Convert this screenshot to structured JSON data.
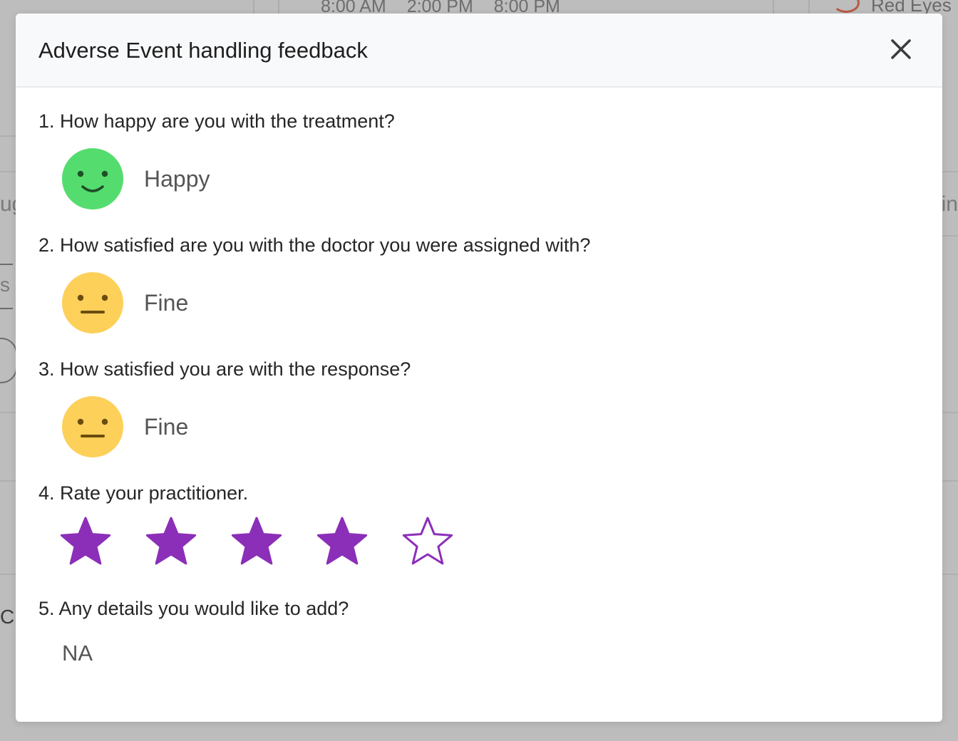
{
  "background": {
    "times": [
      "8:00 AM",
      "2:00 PM",
      "8:00 PM"
    ],
    "top_right_text": "Red Eyes",
    "left_fragments": [
      "ug",
      "s",
      "C"
    ],
    "right_fragments": [
      "in"
    ]
  },
  "modal": {
    "title": "Adverse Event handling feedback",
    "questions": [
      {
        "label": "1. How happy are you with the treatment?",
        "answer": "Happy",
        "face": "smile-face-icon",
        "color": "#55dc6e"
      },
      {
        "label": "2. How satisfied are you with the doctor you were assigned with?",
        "answer": "Fine",
        "face": "neutral-face-icon",
        "color": "#fdd05a"
      },
      {
        "label": "3. How satisfied you are with the response?",
        "answer": "Fine",
        "face": "neutral-face-icon",
        "color": "#fdd05a"
      },
      {
        "label": "4. Rate your practitioner.",
        "rating": 4,
        "max_rating": 5,
        "color": "#8b2fb8"
      },
      {
        "label": "5. Any details you would like to add?",
        "answer": "NA"
      }
    ]
  }
}
